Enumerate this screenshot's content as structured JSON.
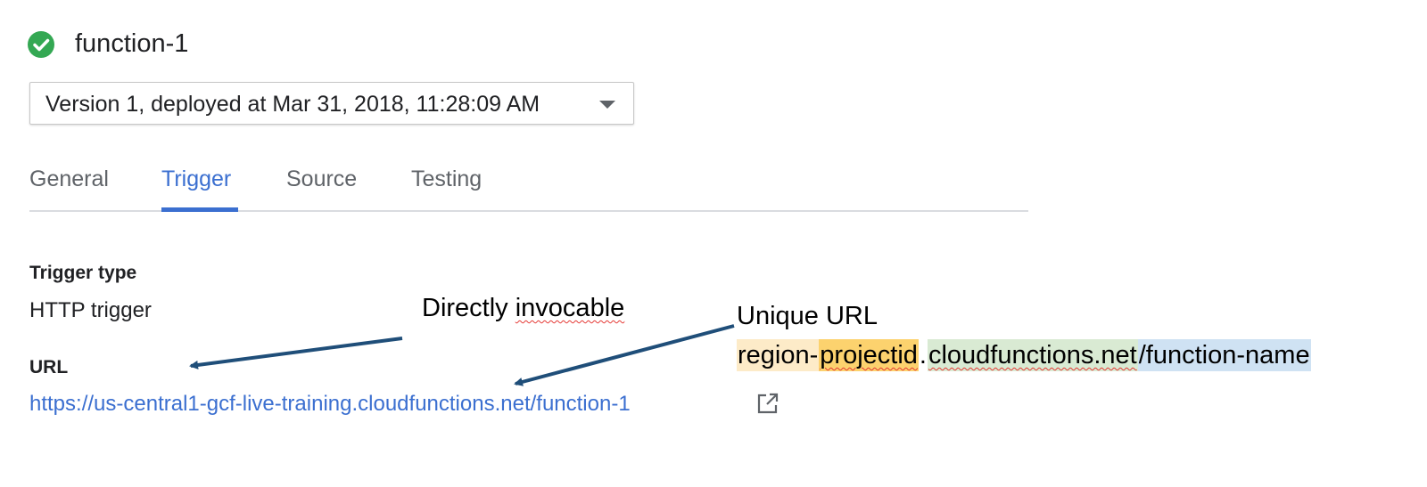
{
  "header": {
    "status_icon": "check-circle-icon",
    "status_color": "#34a853",
    "function_name": "function-1"
  },
  "version_select": {
    "selected": "Version 1, deployed at Mar 31, 2018, 11:28:09 AM",
    "icon": "caret-down-icon"
  },
  "tabs": [
    {
      "label": "General",
      "active": false
    },
    {
      "label": "Trigger",
      "active": true
    },
    {
      "label": "Source",
      "active": false
    },
    {
      "label": "Testing",
      "active": false
    }
  ],
  "trigger": {
    "type_label": "Trigger type",
    "type_value": "HTTP trigger",
    "url_label": "URL",
    "url_value": "https://us-central1-gcf-live-training.cloudfunctions.net/function-1",
    "open_icon": "external-link-icon"
  },
  "annotations": {
    "invocable": {
      "prefix": "Directly ",
      "squiggle": "invocable"
    },
    "unique_url": "Unique URL",
    "url_parts": [
      {
        "text": "region-",
        "color": "#fdebc8",
        "squiggle": false
      },
      {
        "text": "projectid",
        "color": "#fcd26e",
        "squiggle": true
      },
      {
        "text": ".",
        "color": "",
        "squiggle": false
      },
      {
        "text": "cloudfunctions.net",
        "color": "#d9ead3",
        "squiggle": true
      },
      {
        "text": "/function-name",
        "color": "#cfe2f3",
        "squiggle": false
      }
    ]
  },
  "colors": {
    "accent": "#3b6fd0",
    "arrow": "#1f4e79"
  }
}
